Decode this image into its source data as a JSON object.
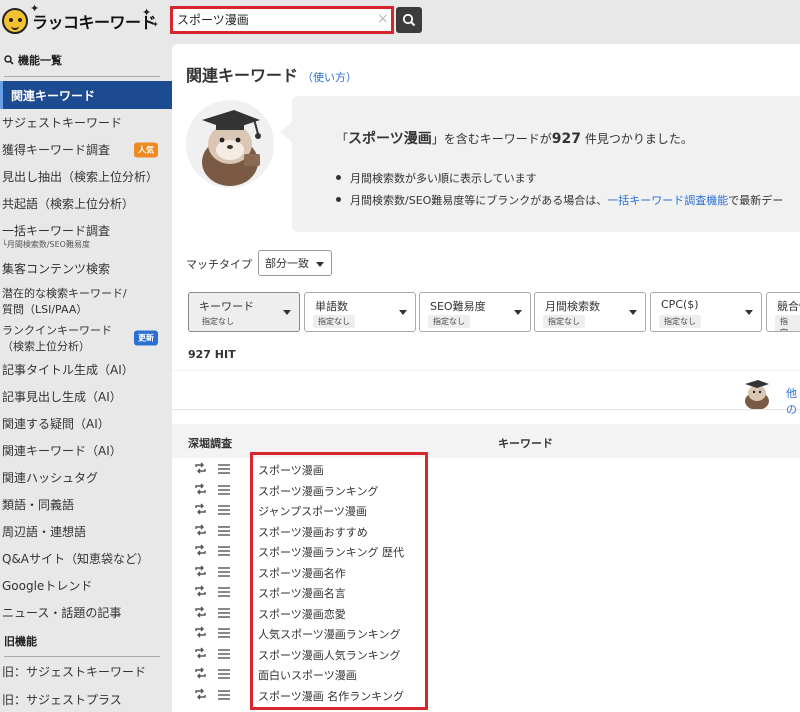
{
  "app": {
    "logo_text": "ラッコキーワード"
  },
  "search": {
    "value": "スポーツ漫画",
    "clear_glyph": "×"
  },
  "sidebar": {
    "section_main": "機能一覧",
    "items": [
      {
        "label": "関連キーワード",
        "active": true
      },
      {
        "label": "サジェストキーワード"
      },
      {
        "label": "獲得キーワード調査",
        "badge": "人気"
      },
      {
        "label": "見出し抽出（検索上位分析）"
      },
      {
        "label": "共起語（検索上位分析）"
      },
      {
        "label": "一括キーワード調査",
        "sub": "└月間検索数/SEO難易度"
      },
      {
        "label": "集客コンテンツ検索"
      },
      {
        "label": "潜在的な検索キーワード/",
        "sub": "質問（LSI/PAA）"
      },
      {
        "label": "ランクインキーワード",
        "sub": "（検索上位分析）",
        "badge": "更新"
      },
      {
        "label": "記事タイトル生成（AI）"
      },
      {
        "label": "記事見出し生成（AI）"
      },
      {
        "label": "関連する疑問（AI）"
      },
      {
        "label": "関連キーワード（AI）"
      },
      {
        "label": "関連ハッシュタグ"
      },
      {
        "label": "類語・同義語"
      },
      {
        "label": "周辺語・連想語"
      },
      {
        "label": "Q&Aサイト（知恵袋など）"
      },
      {
        "label": "Googleトレンド"
      },
      {
        "label": "ニュース・話題の記事"
      }
    ],
    "section_old": "旧機能",
    "old_items": [
      {
        "label": "旧：サジェストキーワード"
      },
      {
        "label": "旧：サジェストプラス"
      }
    ]
  },
  "main": {
    "title": "関連キーワード",
    "how_to": "（使い方）",
    "result": {
      "quote_open": "「",
      "keyword": "スポーツ漫画",
      "quote_close": "」",
      "middle": "を含むキーワードが",
      "count": "927",
      "suffix": "件見つかりました。"
    },
    "notes": [
      {
        "text": "月間検索数が多い順に表示しています"
      },
      {
        "pre": "月間検索数/SEO難易度等にブランクがある場合は、",
        "link": "一括キーワード調査機能",
        "post": "で最新デー"
      }
    ],
    "match_label": "マッチタイプ",
    "match_value": "部分一致",
    "filters": [
      {
        "label": "キーワード",
        "chip": "指定なし"
      },
      {
        "label": "単語数",
        "chip": "指定なし"
      },
      {
        "label": "SEO難易度",
        "chip": "指定なし"
      },
      {
        "label": "月間検索数",
        "chip": "指定なし"
      },
      {
        "label": "CPC($)",
        "chip": "指定なし"
      },
      {
        "label": "競合性",
        "chip": "指定なし"
      }
    ],
    "hit_count": "927 HIT",
    "other_link": "他の",
    "table": {
      "col_dig": "深堀調査",
      "col_keyword": "キーワード",
      "rows": [
        "スポーツ漫画",
        "スポーツ漫画ランキング",
        "ジャンプスポーツ漫画",
        "スポーツ漫画おすすめ",
        "スポーツ漫画ランキング 歴代",
        "スポーツ漫画名作",
        "スポーツ漫画名言",
        "スポーツ漫画恋愛",
        "人気スポーツ漫画ランキング",
        "スポーツ漫画人気ランキング",
        "面白いスポーツ漫画",
        "スポーツ漫画 名作ランキング"
      ]
    }
  },
  "colors": {
    "accent_blue": "#1d4b92",
    "link_blue": "#2a6fd1",
    "highlight_red": "#d7262e",
    "badge_orange": "#f08a23"
  }
}
